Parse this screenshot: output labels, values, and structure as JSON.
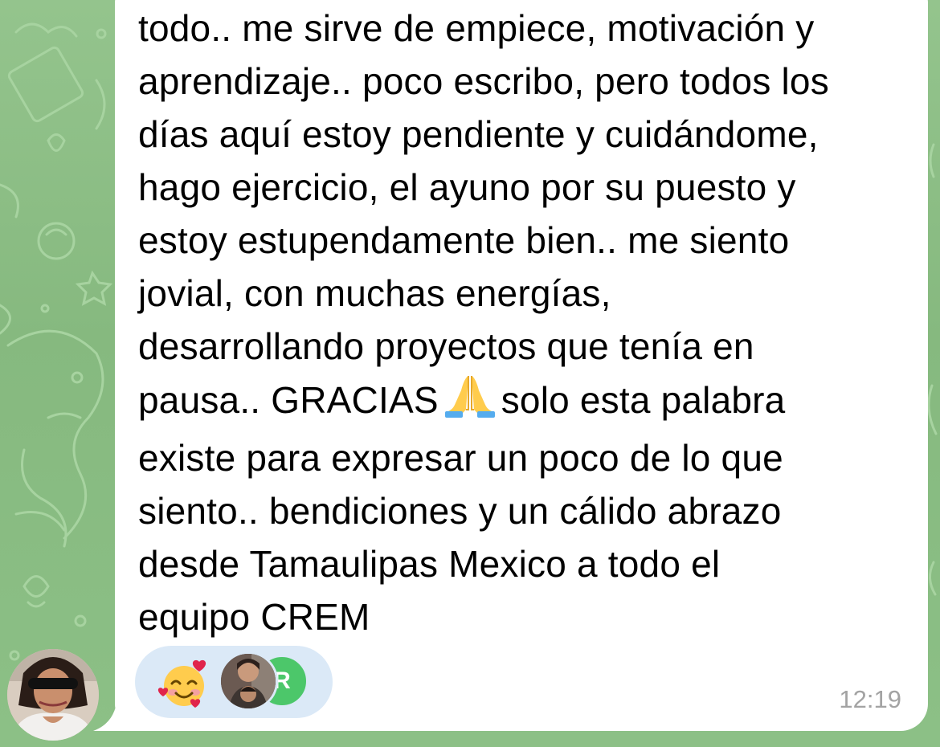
{
  "message": {
    "lines": [
      "todo.. me sirve de empiece, motivación y",
      "aprendizaje.. poco escribo, pero todos los",
      "días aquí estoy pendiente y cuidándome,",
      "hago ejercicio, el ayuno por su puesto y",
      "estoy estupendamente bien.. me siento",
      "jovial, con muchas energías,",
      "desarrollando proyectos que tenía en"
    ],
    "line8_before": "pausa.. GRACIAS",
    "line8_emoji": "folded-hands-emoji",
    "line8_after": "solo esta palabra",
    "lines_after": [
      "existe para expresar un poco de lo que",
      "siento.. bendiciones y un cálido abrazo",
      "desde Tamaulipas Mexico a todo el",
      "equipo CREM"
    ],
    "time": "12:19"
  },
  "reaction": {
    "emoji": "smiling-face-with-hearts-emoji",
    "reactors": [
      {
        "type": "photo",
        "name": "reactor-photo-avatar"
      },
      {
        "type": "initial",
        "initial": "R",
        "color": "#4cc76a"
      }
    ]
  },
  "sender": {
    "avatar": "sender-photo-avatar"
  },
  "colors": {
    "wallpaper": "#8fbf8a",
    "bubble": "#ffffff",
    "reaction_pill": "#dbe9f7",
    "timestamp": "#a3a3a3"
  }
}
